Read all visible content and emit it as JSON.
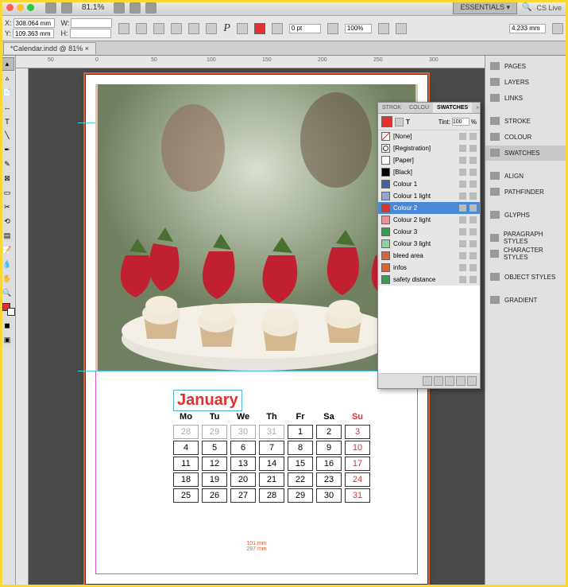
{
  "menubar": {
    "zoom": "81.1%",
    "essentials": "ESSENTIALS ▾",
    "cslive": "CS Live"
  },
  "controlbar": {
    "x_label": "X:",
    "x_val": "308.064 mm",
    "y_label": "Y:",
    "y_val": "109.363 mm",
    "w_label": "W:",
    "w_val": "",
    "h_label": "H:",
    "h_val": "",
    "stroke_pt": "0 pt",
    "opacity": "100%",
    "indent": "4.233 mm"
  },
  "doctab": "*Calendar.indd @ 81%",
  "ruler_marks": [
    "50",
    "0",
    "50",
    "100",
    "150",
    "200",
    "250",
    "300"
  ],
  "rightpanels": {
    "pages": "PAGES",
    "layers": "LAYERS",
    "links": "LINKS",
    "stroke": "STROKE",
    "colour": "COLOUR",
    "swatches": "SWATCHES",
    "align": "ALIGN",
    "pathfinder": "PATHFINDER",
    "glyphs": "GLYPHS",
    "parastyles": "PARAGRAPH STYLES",
    "charstyles": "CHARACTER STYLES",
    "objstyles": "OBJECT STYLES",
    "gradient": "GRADIENT"
  },
  "swatches_panel": {
    "tab_stroke": "STROK",
    "tab_colour": "COLOU",
    "tab_swatches": "SWATCHES",
    "tint_label": "Tint:",
    "tint_val": "100",
    "tint_pct": "%",
    "rows": [
      {
        "name": "[None]",
        "color": "none"
      },
      {
        "name": "[Registration]",
        "color": "reg"
      },
      {
        "name": "[Paper]",
        "color": "#ffffff"
      },
      {
        "name": "[Black]",
        "color": "#000000"
      },
      {
        "name": "Colour 1",
        "color": "#4060a0"
      },
      {
        "name": "Colour 1 light",
        "color": "#90a8d0"
      },
      {
        "name": "Colour 2",
        "color": "#e03030",
        "selected": true
      },
      {
        "name": "Colour 2 light",
        "color": "#f09090"
      },
      {
        "name": "Colour 3",
        "color": "#30a050"
      },
      {
        "name": "Colour 3 light",
        "color": "#90d0a0"
      },
      {
        "name": "bleed area",
        "color": "#e06030"
      },
      {
        "name": "infos",
        "color": "#e06030"
      },
      {
        "name": "safety distance",
        "color": "#30a050"
      }
    ]
  },
  "calendar": {
    "month": "January",
    "days": [
      "Mo",
      "Tu",
      "We",
      "Th",
      "Fr",
      "Sa",
      "Su"
    ],
    "rows": [
      [
        {
          "n": "28",
          "p": true
        },
        {
          "n": "29",
          "p": true
        },
        {
          "n": "30",
          "p": true
        },
        {
          "n": "31",
          "p": true
        },
        {
          "n": "1"
        },
        {
          "n": "2"
        },
        {
          "n": "3",
          "s": true
        }
      ],
      [
        {
          "n": "4"
        },
        {
          "n": "5"
        },
        {
          "n": "6"
        },
        {
          "n": "7"
        },
        {
          "n": "8"
        },
        {
          "n": "9"
        },
        {
          "n": "10",
          "s": true
        }
      ],
      [
        {
          "n": "11"
        },
        {
          "n": "12"
        },
        {
          "n": "13"
        },
        {
          "n": "14"
        },
        {
          "n": "15"
        },
        {
          "n": "16"
        },
        {
          "n": "17",
          "s": true
        }
      ],
      [
        {
          "n": "18"
        },
        {
          "n": "19"
        },
        {
          "n": "20"
        },
        {
          "n": "21"
        },
        {
          "n": "22"
        },
        {
          "n": "23"
        },
        {
          "n": "24",
          "s": true
        }
      ],
      [
        {
          "n": "25"
        },
        {
          "n": "26"
        },
        {
          "n": "27"
        },
        {
          "n": "28"
        },
        {
          "n": "29"
        },
        {
          "n": "30"
        },
        {
          "n": "31",
          "s": true
        }
      ]
    ],
    "foot1": "101 mm",
    "foot2": "297 mm"
  }
}
